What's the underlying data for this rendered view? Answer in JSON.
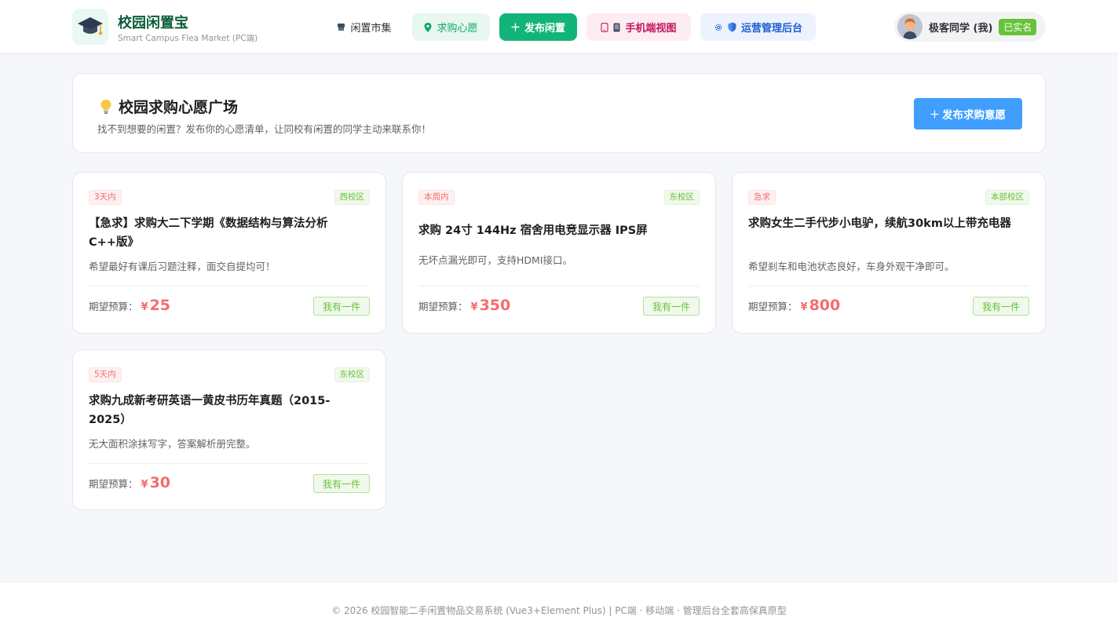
{
  "header": {
    "brand_title": "校园闲置宝",
    "brand_subtitle": "Smart Campus Flea Market (PC端)",
    "nav": {
      "market": "闲置市集",
      "wish": "求购心愿",
      "publish": "发布闲置",
      "mobile": "手机端视图",
      "admin": "运营管理后台"
    },
    "user": {
      "name": "极客同学 (我)",
      "verified_badge": "已实名"
    }
  },
  "banner": {
    "title": "校园求购心愿广场",
    "subtitle": "找不到想要的闲置？发布你的心愿清单，让同校有闲置的同学主动来联系你！",
    "button_label": "发布求购意愿"
  },
  "budget_label": "期望预算：",
  "currency_symbol": "¥",
  "have_one_label": "我有一件",
  "wishes": [
    {
      "time_tag": "3天内",
      "campus": "西校区",
      "title": "【急求】求购大二下学期《数据结构与算法分析C++版》",
      "desc": "希望最好有课后习题注释，面交自提均可！",
      "budget": "25"
    },
    {
      "time_tag": "本周内",
      "campus": "东校区",
      "title": "求购 24寸 144Hz 宿舍用电竞显示器 IPS屏",
      "desc": "无坏点漏光即可，支持HDMI接口。",
      "budget": "350"
    },
    {
      "time_tag": "急求",
      "campus": "本部校区",
      "title": "求购女生二手代步小电驴，续航30km以上带充电器",
      "desc": "希望刹车和电池状态良好，车身外观干净即可。",
      "budget": "800"
    },
    {
      "time_tag": "5天内",
      "campus": "东校区",
      "title": "求购九成新考研英语一黄皮书历年真题（2015-2025）",
      "desc": "无大面积涂抹写字，答案解析册完整。",
      "budget": "30"
    }
  ],
  "footer": {
    "text": "© 2026 校园智能二手闲置物品交易系统 (Vue3+Element Plus) | PC端 · 移动端 · 管理后台全套高保真原型"
  },
  "colors": {
    "primary_green": "#13b479",
    "accent_blue": "#409eff",
    "price_red": "#f56c6c",
    "tag_green": "#67c23a"
  }
}
